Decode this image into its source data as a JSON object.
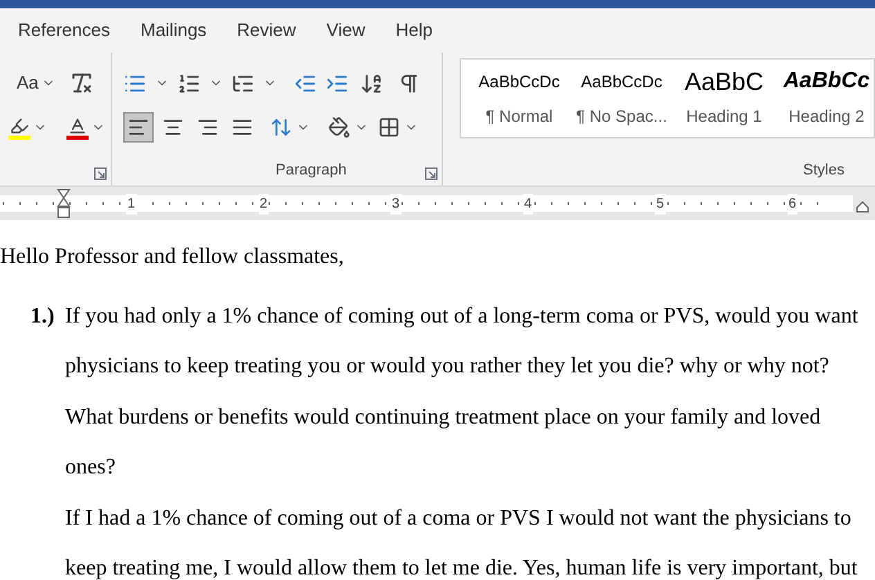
{
  "tabs": [
    {
      "label": "References",
      "selected": false
    },
    {
      "label": "Mailings",
      "selected": false
    },
    {
      "label": "Review",
      "selected": false
    },
    {
      "label": "View",
      "selected": false
    },
    {
      "label": "Help",
      "selected": false
    }
  ],
  "font_group": {
    "change_case_label": "Aa",
    "color_buttons": [
      {
        "kind": "highlight",
        "color": "#ffff00"
      },
      {
        "kind": "font_color",
        "color": "#e00000"
      }
    ]
  },
  "paragraph_group": {
    "label": "Paragraph",
    "align_buttons": [
      {
        "kind": "left",
        "selected": true
      },
      {
        "kind": "center",
        "selected": false
      },
      {
        "kind": "right",
        "selected": false
      },
      {
        "kind": "justify",
        "selected": false
      }
    ]
  },
  "styles_group": {
    "label": "Styles",
    "items": [
      {
        "preview": "AaBbCcDc",
        "name": "¶ Normal",
        "kind": "normal"
      },
      {
        "preview": "AaBbCcDc",
        "name": "¶ No Spac...",
        "kind": "normal"
      },
      {
        "preview": "AaBbC",
        "name": "Heading 1",
        "kind": "heading1"
      },
      {
        "preview": "AaBbCc",
        "name": "Heading 2",
        "kind": "heading2"
      }
    ]
  },
  "ruler": {
    "numbers": [
      "1",
      "2",
      "3",
      "4",
      "5",
      "6"
    ]
  },
  "document": {
    "greeting": "Hello Professor and fellow classmates,",
    "items": [
      {
        "number": "1.)",
        "question": "If you had only a 1% chance of coming out of a long-term coma or PVS, would you want physicians to keep treating you or would you rather they let you die? why or why not? What burdens or benefits would continuing treatment place on your family and loved ones?",
        "answer": "If I had a 1% chance of coming out of a coma or PVS I would not want the physicians to keep treating me, I would allow them to let me die. Yes, human life is very important, but"
      }
    ]
  }
}
